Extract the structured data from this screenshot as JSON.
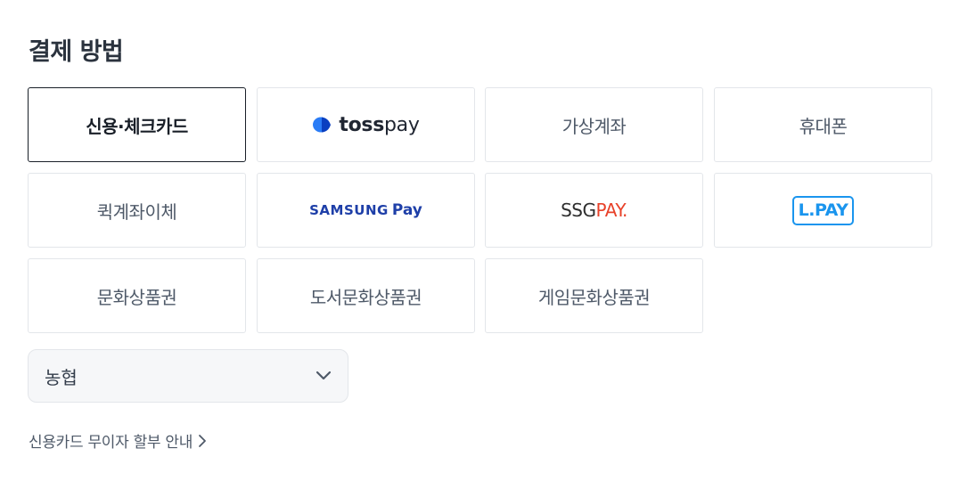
{
  "section_title": "결제 방법",
  "methods": {
    "card": "신용·체크카드",
    "toss_pay": "tosspay",
    "virtual_account": "가상계좌",
    "phone": "휴대폰",
    "quick_transfer": "퀵계좌이체",
    "samsung_pay": "SAMSUNG Pay",
    "ssg_pay": "SSGPAY.",
    "l_pay": "L.PAY",
    "culture_gift": "문화상품권",
    "book_gift": "도서문화상품권",
    "game_gift": "게임문화상품권"
  },
  "toss_logo": {
    "bold": "toss",
    "light": "pay"
  },
  "samsung_logo": {
    "brand": "SAMSUNG",
    "pay": "Pay"
  },
  "ssg_logo": {
    "part1": "SSG",
    "part2": "PAY."
  },
  "bank_select": {
    "selected": "농협"
  },
  "installment_link": "신용카드 무이자 할부 안내",
  "colors": {
    "selected_border": "#191f28",
    "toss_blue": "#0064ff",
    "samsung_blue": "#1e3fa8",
    "ssg_red": "#e8422a",
    "lpay_blue": "#1a95ee"
  },
  "icons": {
    "select_arrow": "chevron-down-icon",
    "link_arrow": "chevron-right-icon"
  }
}
